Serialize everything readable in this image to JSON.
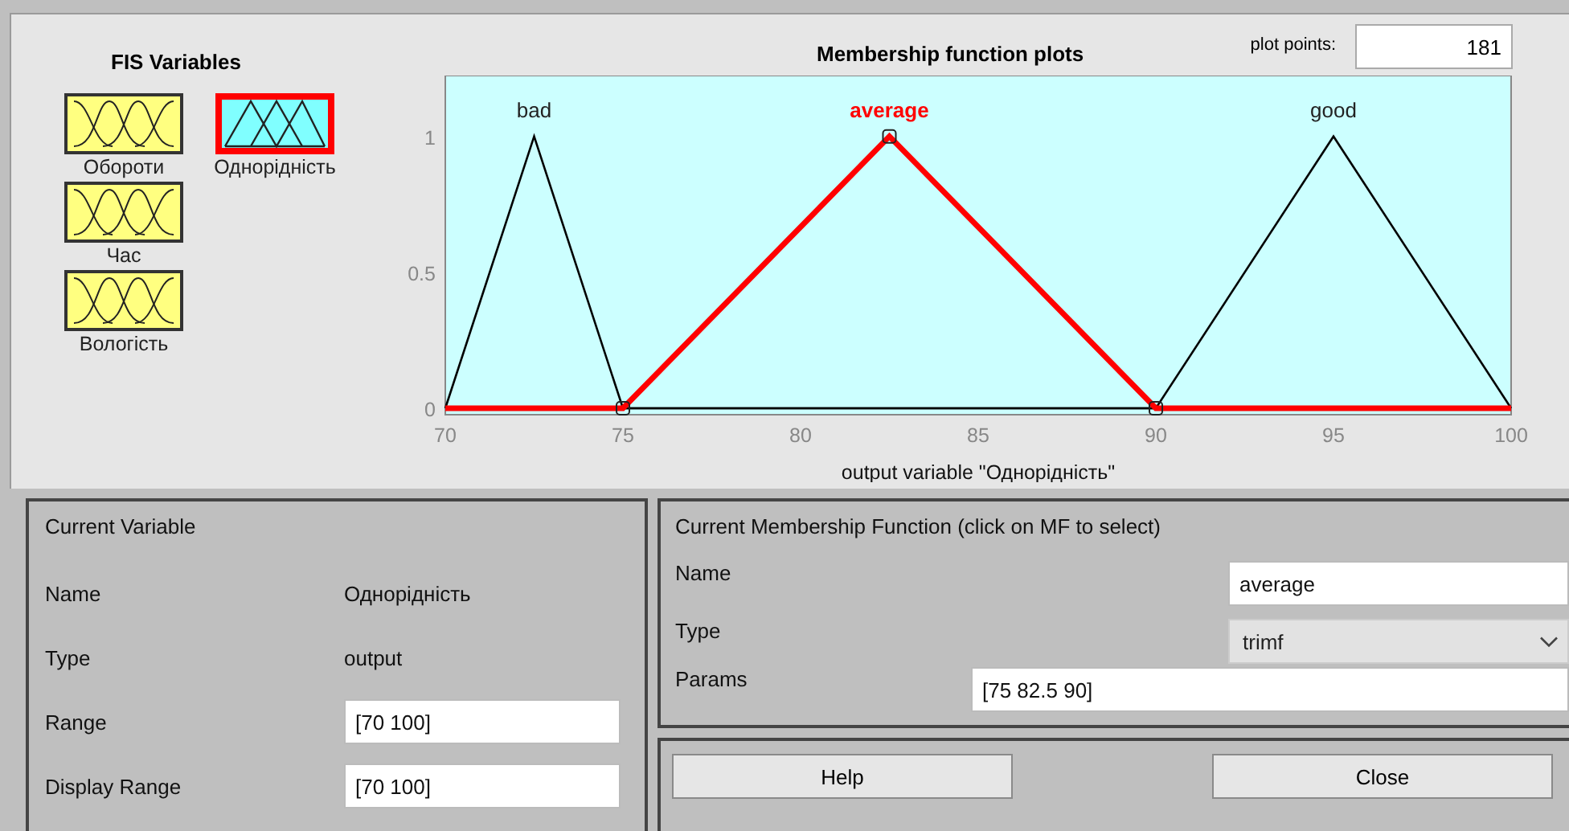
{
  "fis_variables": {
    "title": "FIS Variables",
    "items": [
      {
        "name": "Обороти",
        "kind": "input",
        "selected": false
      },
      {
        "name": "Однорідність",
        "kind": "output",
        "selected": true
      },
      {
        "name": "Час",
        "kind": "input",
        "selected": false
      },
      {
        "name": "Вологість",
        "kind": "input",
        "selected": false
      }
    ]
  },
  "plot": {
    "title": "Membership function plots",
    "plot_points_label": "plot points:",
    "plot_points": "181",
    "chart_data": {
      "type": "line",
      "xlabel": "output variable \"Однорідність\"",
      "x": [
        70,
        72.5,
        75,
        82.5,
        90,
        95,
        100
      ],
      "xlim": [
        70,
        100
      ],
      "ylim": [
        0,
        1.2
      ],
      "xticks": [
        70,
        75,
        80,
        85,
        90,
        95,
        100
      ],
      "yticks": [
        0,
        {
          "value": 0.5,
          "label": "0.5"
        },
        1
      ],
      "series": [
        {
          "name": "bad",
          "color": "#000000",
          "values": [
            0,
            1,
            0,
            0,
            0,
            0,
            0
          ]
        },
        {
          "name": "average",
          "color": "#ff0000",
          "values": [
            0,
            0,
            0,
            1,
            0,
            0,
            0
          ]
        },
        {
          "name": "good",
          "color": "#000000",
          "values": [
            0,
            0,
            0,
            0,
            0,
            1,
            0
          ]
        }
      ]
    },
    "membership_functions": [
      {
        "selected": false
      },
      {
        "selected": true
      },
      {
        "selected": false
      }
    ]
  },
  "current_variable": {
    "title": "Current Variable",
    "rows": [
      {
        "label": "Name",
        "value": "Однорідність",
        "kind": "text"
      },
      {
        "label": "Type",
        "value": "output",
        "kind": "text"
      },
      {
        "label": "Range",
        "value": "[70 100]",
        "kind": "field"
      },
      {
        "label": "Display Range",
        "value": "[70 100]",
        "kind": "field"
      }
    ]
  },
  "current_mf": {
    "title": "Current Membership Function (click on MF to select)",
    "name_label": "Name",
    "name": "average",
    "type_label": "Type",
    "type": "trimf",
    "params_label": "Params",
    "params": "[75 82.5 90]"
  },
  "buttons": [
    "Help",
    "Close"
  ]
}
